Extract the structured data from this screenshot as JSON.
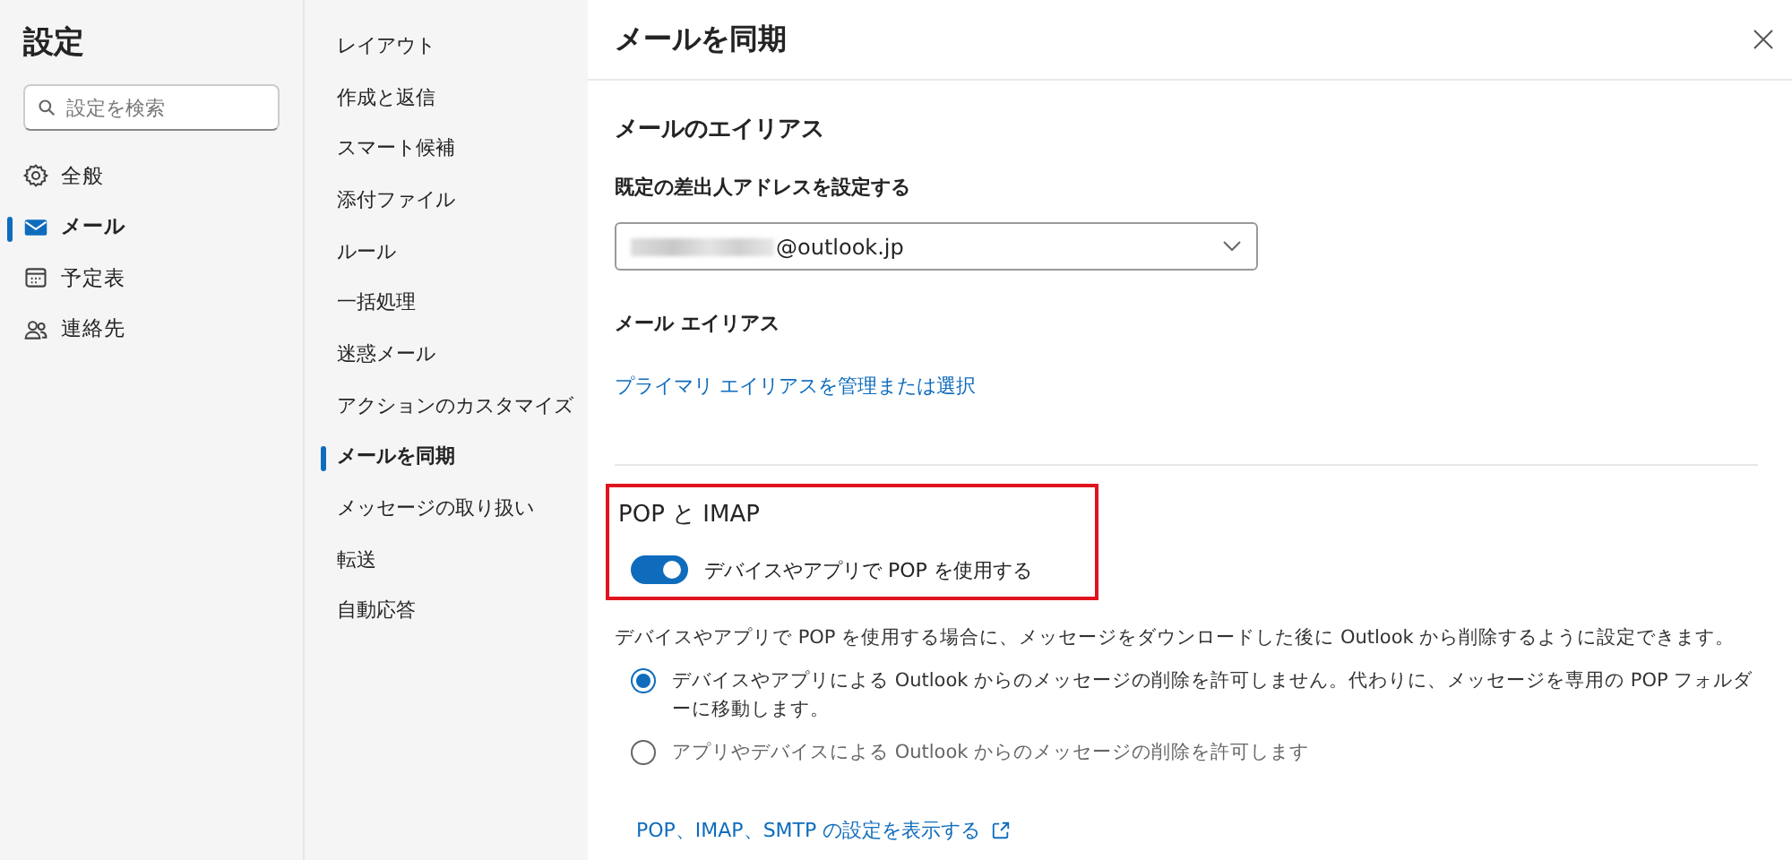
{
  "settings": {
    "title": "設定",
    "search": {
      "placeholder": "設定を検索"
    },
    "categories": [
      {
        "label": "全般",
        "kind": "gear",
        "selected": false
      },
      {
        "label": "メール",
        "kind": "mail",
        "selected": true
      },
      {
        "label": "予定表",
        "kind": "calendar",
        "selected": false
      },
      {
        "label": "連絡先",
        "kind": "people",
        "selected": false
      }
    ]
  },
  "submenu": [
    {
      "label": "レイアウト",
      "selected": false
    },
    {
      "label": "作成と返信",
      "selected": false
    },
    {
      "label": "スマート候補",
      "selected": false
    },
    {
      "label": "添付ファイル",
      "selected": false
    },
    {
      "label": "ルール",
      "selected": false
    },
    {
      "label": "一括処理",
      "selected": false
    },
    {
      "label": "迷惑メール",
      "selected": false
    },
    {
      "label": "アクションのカスタマイズ",
      "selected": false
    },
    {
      "label": "メールを同期",
      "selected": true
    },
    {
      "label": "メッセージの取り扱い",
      "selected": false
    },
    {
      "label": "転送",
      "selected": false
    },
    {
      "label": "自動応答",
      "selected": false
    }
  ],
  "panel": {
    "title": "メールを同期",
    "alias": {
      "heading": "メールのエイリアス",
      "address_label": "既定の差出人アドレスを設定する",
      "address_value": "@outlook.jp",
      "alias_label": "メール エイリアス",
      "alias_link": "プライマリ エイリアスを管理または選択"
    },
    "pop": {
      "heading": "POP と IMAP",
      "toggle": {
        "label": "デバイスやアプリで POP を使用する",
        "on": true
      },
      "description": "デバイスやアプリで POP を使用する場合に、メッセージをダウンロードした後に Outlook から削除するように設定できます。",
      "options": [
        {
          "label": "デバイスやアプリによる Outlook からのメッセージの削除を許可しません。代わりに、メッセージを専用の POP フォルダーに移動します。",
          "selected": true
        },
        {
          "label": "アプリやデバイスによる Outlook からのメッセージの削除を許可します",
          "selected": false
        }
      ],
      "link": "POP、IMAP、SMTP の設定を表示する"
    }
  }
}
